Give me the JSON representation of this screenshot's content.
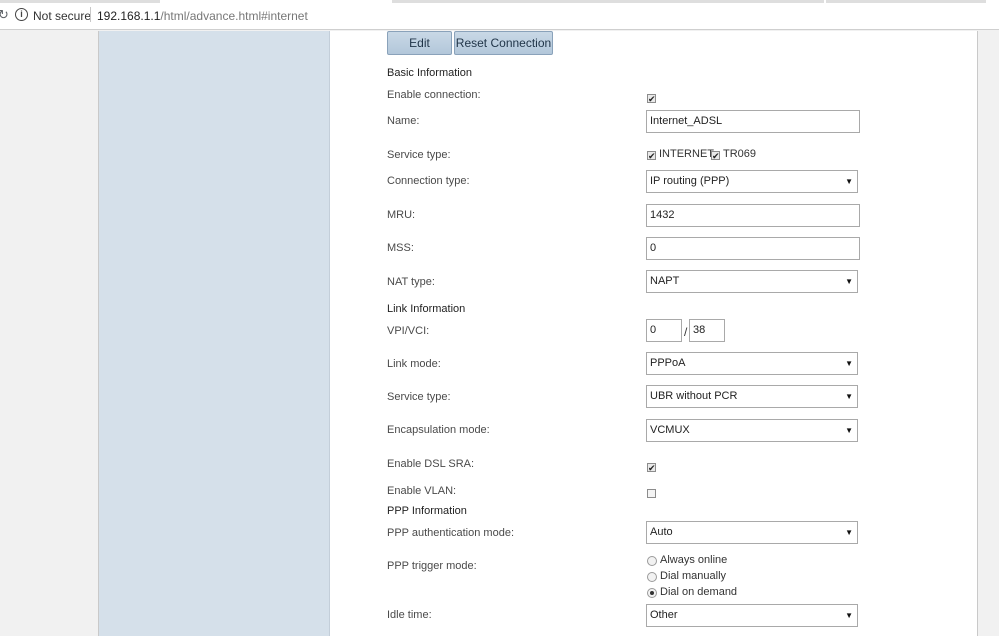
{
  "browser": {
    "security_label": "Not secure",
    "url_host": "192.168.1.1",
    "url_path": "/html/advance.html#internet"
  },
  "toolbar": {
    "edit_label": "Edit",
    "reset_label": "Reset Connection"
  },
  "basic": {
    "heading": "Basic Information",
    "enable_connection": {
      "label": "Enable connection:",
      "checked": true
    },
    "name": {
      "label": "Name:",
      "value": "Internet_ADSL"
    },
    "service_type": {
      "label": "Service type:",
      "opt1": "INTERNET",
      "opt2": "TR069"
    },
    "connection_type": {
      "label": "Connection type:",
      "value": "IP routing (PPP)"
    },
    "mru": {
      "label": "MRU:",
      "value": "1432"
    },
    "mss": {
      "label": "MSS:",
      "value": "0"
    },
    "nat_type": {
      "label": "NAT type:",
      "value": "NAPT"
    }
  },
  "link": {
    "heading": "Link Information",
    "vpi_vci": {
      "label": "VPI/VCI:",
      "vpi": "0",
      "vci": "38",
      "separator": "/"
    },
    "link_mode": {
      "label": "Link mode:",
      "value": "PPPoA"
    },
    "service_type": {
      "label": "Service type:",
      "value": "UBR without PCR"
    },
    "encapsulation": {
      "label": "Encapsulation mode:",
      "value": "VCMUX"
    },
    "dsl_sra": {
      "label": "Enable DSL SRA:",
      "checked": true
    },
    "vlan": {
      "label": "Enable VLAN:",
      "checked": false
    }
  },
  "ppp": {
    "heading": "PPP Information",
    "auth_mode": {
      "label": "PPP authentication mode:",
      "value": "Auto"
    },
    "trigger_mode": {
      "label": "PPP trigger mode:",
      "options": [
        "Always online",
        "Dial manually",
        "Dial on demand"
      ],
      "selected": "Dial on demand"
    },
    "idle_time": {
      "label": "Idle time:",
      "value": "Other"
    }
  },
  "icons": {
    "dropdown": "chevron-down-icon",
    "check_glyph": "✔",
    "arrow_glyph": "▼"
  },
  "colors": {
    "sidebar": "#d5e0ea",
    "button": "#b3c7da"
  }
}
